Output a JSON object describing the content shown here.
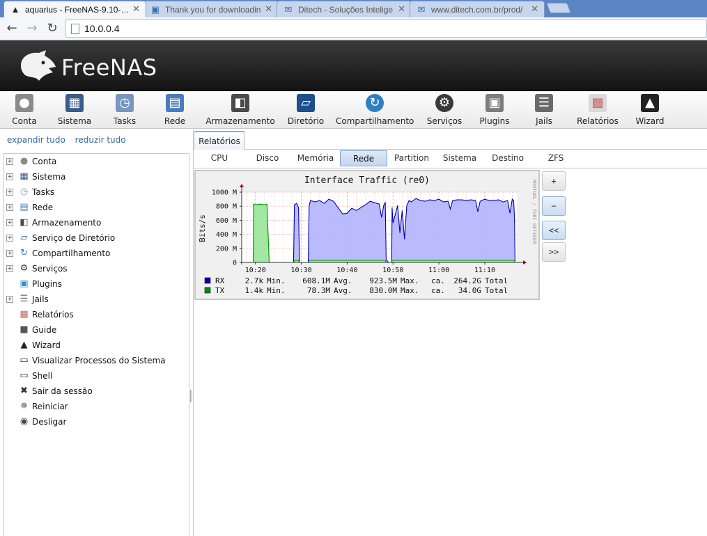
{
  "browser": {
    "tabs": [
      {
        "label": "aquarius - FreeNAS-9.10-…",
        "icon": "freenas-icon",
        "active": true
      },
      {
        "label": "Thank you for downloadin",
        "icon": "page-icon",
        "active": false
      },
      {
        "label": "Ditech - Soluções Intelige",
        "icon": "mail-icon",
        "active": false
      },
      {
        "label": "www.ditech.com.br/prod/",
        "icon": "mail-icon",
        "active": false
      }
    ],
    "url": "10.0.0.4"
  },
  "brand": "FreeNAS",
  "toolbar": [
    {
      "label": "Conta",
      "icon": "users-icon",
      "color": "#8a8a8a"
    },
    {
      "label": "Sistema",
      "icon": "system-icon",
      "color": "#3b5b8a"
    },
    {
      "label": "Tasks",
      "icon": "clock-icon",
      "color": "#7895bd"
    },
    {
      "label": "Rede",
      "icon": "network-icon",
      "color": "#4a7bbf"
    },
    {
      "label": "Armazenamento",
      "icon": "storage-icon",
      "color": "#4a4a4a"
    },
    {
      "label": "Diretório",
      "icon": "directory-icon",
      "color": "#1f4f8f"
    },
    {
      "label": "Compartilhamento",
      "icon": "share-icon",
      "color": "#2f7fc1"
    },
    {
      "label": "Serviços",
      "icon": "gears-icon",
      "color": "#3a3a3a"
    },
    {
      "label": "Plugins",
      "icon": "plugin-icon",
      "color": "#7d7d7d"
    },
    {
      "label": "Jails",
      "icon": "jail-icon",
      "color": "#6a6a6a"
    },
    {
      "label": "Relatórios",
      "icon": "report-icon",
      "color": "#d9d9d9"
    },
    {
      "label": "Wizard",
      "icon": "wizard-hat-icon",
      "color": "#222222"
    }
  ],
  "tree": {
    "expand_all": "expandir tudo",
    "collapse_all": "reduzir tudo",
    "items": [
      {
        "label": "Conta",
        "expandable": true,
        "icon": "users-icon",
        "color": "#8a8a8a"
      },
      {
        "label": "Sistema",
        "expandable": true,
        "icon": "system-icon",
        "color": "#3b5b8a"
      },
      {
        "label": "Tasks",
        "expandable": true,
        "icon": "clock-icon",
        "color": "#7895bd"
      },
      {
        "label": "Rede",
        "expandable": true,
        "icon": "network-icon",
        "color": "#4a7bbf"
      },
      {
        "label": "Armazenamento",
        "expandable": true,
        "icon": "storage-icon",
        "color": "#4a4a4a"
      },
      {
        "label": "Serviço de Diretório",
        "expandable": true,
        "icon": "directory-icon",
        "color": "#1f4f8f"
      },
      {
        "label": "Compartilhamento",
        "expandable": true,
        "icon": "share-icon",
        "color": "#2f7fc1"
      },
      {
        "label": "Serviços",
        "expandable": true,
        "icon": "gears-icon",
        "color": "#3a3a3a"
      },
      {
        "label": "Plugins",
        "expandable": false,
        "icon": "plugin-icon",
        "color": "#2f8fd6"
      },
      {
        "label": "Jails",
        "expandable": true,
        "icon": "jail-icon",
        "color": "#6a6a6a"
      },
      {
        "label": "Relatórios",
        "expandable": false,
        "icon": "report-icon",
        "color": "#c96a5a"
      },
      {
        "label": "Guide",
        "expandable": false,
        "icon": "guide-icon",
        "color": "#555555"
      },
      {
        "label": "Wizard",
        "expandable": false,
        "icon": "wizard-hat-icon",
        "color": "#222222"
      },
      {
        "label": "Visualizar Processos do Sistema",
        "expandable": false,
        "icon": "process-icon",
        "color": "#333333"
      },
      {
        "label": "Shell",
        "expandable": false,
        "icon": "shell-icon",
        "color": "#333333"
      },
      {
        "label": "Sair da sessão",
        "expandable": false,
        "icon": "close-x-icon",
        "color": "#333333"
      },
      {
        "label": "Reiniciar",
        "expandable": false,
        "icon": "restart-icon",
        "color": "#555555"
      },
      {
        "label": "Desligar",
        "expandable": false,
        "icon": "power-icon",
        "color": "#444444"
      }
    ]
  },
  "reports": {
    "main_tab": "Relatórios",
    "subtabs": [
      "CPU",
      "Disco",
      "Memória",
      "Rede",
      "Partition",
      "Sistema",
      "Destino",
      "ZFS"
    ],
    "selected_subtab": "Rede",
    "zoom_in": "+",
    "zoom_out": "−",
    "prev": "<<",
    "next": ">>"
  },
  "chart_data": {
    "type": "area",
    "title": "Interface Traffic (re0)",
    "ylabel": "Bits/s",
    "watermark": "RRDTOOL / TOBI OETIKER",
    "ylim": [
      0,
      1000000000
    ],
    "ytick_labels": [
      "1000 M",
      "800 M",
      "600 M",
      "400 M",
      "200 M",
      "0"
    ],
    "yticks": [
      1000,
      800,
      600,
      400,
      200,
      0
    ],
    "xlim": [
      "10:17",
      "11:21"
    ],
    "xtick_labels": [
      "10:20",
      "10:30",
      "10:40",
      "10:50",
      "11:00",
      "11:10"
    ],
    "xticks_min": [
      20,
      30,
      40,
      50,
      60,
      70
    ],
    "series": [
      {
        "name": "RX",
        "color": "#0000b0",
        "fill": "#b6b6ff",
        "unit": "Mbit/s",
        "points": [
          [
            17,
            0
          ],
          [
            19.5,
            0
          ],
          [
            19.6,
            0
          ],
          [
            20,
            0
          ],
          [
            22,
            0
          ],
          [
            23,
            0
          ],
          [
            28.3,
            0
          ],
          [
            28.5,
            820
          ],
          [
            29,
            840
          ],
          [
            29.4,
            780
          ],
          [
            29.6,
            0
          ],
          [
            30,
            0
          ],
          [
            31,
            0
          ],
          [
            31.5,
            0
          ],
          [
            31.7,
            800
          ],
          [
            32,
            880
          ],
          [
            33,
            860
          ],
          [
            34,
            880
          ],
          [
            35,
            840
          ],
          [
            36,
            900
          ],
          [
            37,
            870
          ],
          [
            38,
            780
          ],
          [
            39,
            690
          ],
          [
            40,
            700
          ],
          [
            41,
            770
          ],
          [
            42,
            740
          ],
          [
            43,
            780
          ],
          [
            44,
            820
          ],
          [
            45,
            870
          ],
          [
            46,
            850
          ],
          [
            47,
            830
          ],
          [
            47.5,
            640
          ],
          [
            48,
            820
          ],
          [
            48.3,
            850
          ],
          [
            48.5,
            40
          ],
          [
            49,
            0
          ],
          [
            49.7,
            0
          ],
          [
            49.8,
            780
          ],
          [
            50,
            560
          ],
          [
            51,
            810
          ],
          [
            51.5,
            420
          ],
          [
            52,
            740
          ],
          [
            52.5,
            330
          ],
          [
            53,
            810
          ],
          [
            53.5,
            880
          ],
          [
            54,
            860
          ],
          [
            55,
            910
          ],
          [
            56,
            880
          ],
          [
            57,
            870
          ],
          [
            58,
            890
          ],
          [
            59,
            880
          ],
          [
            60,
            900
          ],
          [
            61,
            860
          ],
          [
            62,
            870
          ],
          [
            62.5,
            760
          ],
          [
            63,
            880
          ],
          [
            64,
            890
          ],
          [
            65,
            890
          ],
          [
            66,
            880
          ],
          [
            67,
            890
          ],
          [
            68,
            880
          ],
          [
            68.5,
            720
          ],
          [
            69,
            870
          ],
          [
            70,
            900
          ],
          [
            71,
            880
          ],
          [
            72,
            880
          ],
          [
            73,
            890
          ],
          [
            74,
            860
          ],
          [
            75,
            880
          ],
          [
            75.5,
            700
          ],
          [
            76,
            900
          ],
          [
            76.3,
            880
          ],
          [
            76.5,
            620
          ],
          [
            76.6,
            0
          ],
          [
            77,
            0
          ]
        ],
        "min": "2.7k",
        "avg": "608.1M",
        "max": "923.5M",
        "total": "264.2G"
      },
      {
        "name": "TX",
        "color": "#009000",
        "fill": "#9de69d",
        "unit": "Mbit/s",
        "points": [
          [
            17,
            0
          ],
          [
            19.5,
            0
          ],
          [
            19.6,
            830
          ],
          [
            20,
            820
          ],
          [
            21,
            830
          ],
          [
            22,
            820
          ],
          [
            22.5,
            830
          ],
          [
            23,
            0
          ],
          [
            23.2,
            0
          ],
          [
            28.3,
            0
          ],
          [
            28.5,
            30
          ],
          [
            29.4,
            30
          ],
          [
            29.6,
            0
          ],
          [
            31.5,
            0
          ],
          [
            31.7,
            30
          ],
          [
            48.3,
            30
          ],
          [
            48.5,
            0
          ],
          [
            49.7,
            0
          ],
          [
            49.8,
            30
          ],
          [
            76.5,
            30
          ],
          [
            76.6,
            0
          ],
          [
            77,
            0
          ]
        ],
        "min": "1.4k",
        "avg": "78.3M",
        "max": "830.0M",
        "total": "34.0G"
      }
    ],
    "legend": {
      "min_label": "Min.",
      "avg_label": "Avg.",
      "max_label": "Max.",
      "ca_label": "ca.",
      "total_label": "Total"
    }
  }
}
